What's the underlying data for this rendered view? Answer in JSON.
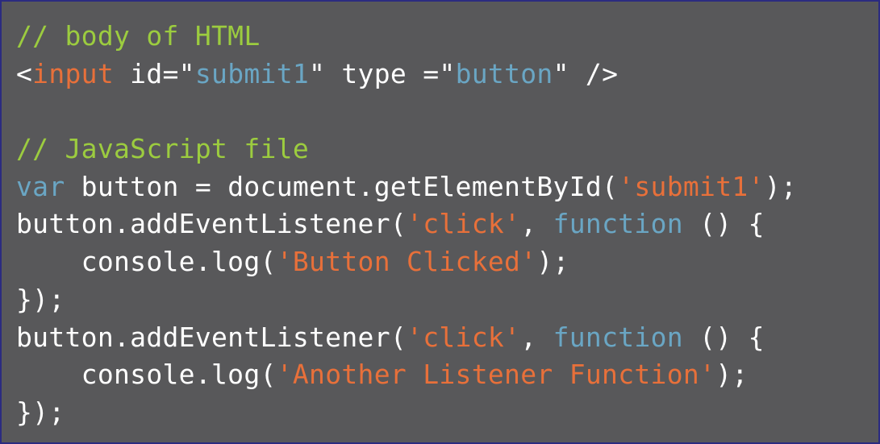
{
  "colors": {
    "background": "#58585a",
    "border": "#2b2b80",
    "comment": "#9ccc3f",
    "tag": "#e8703a",
    "keyword": "#6aa6c4",
    "string": "#e8703a",
    "plain": "#ffffff"
  },
  "code": {
    "lines": [
      [
        {
          "type": "comment",
          "text": "// body of HTML"
        }
      ],
      [
        {
          "type": "plain",
          "text": "<"
        },
        {
          "type": "tag",
          "text": "input"
        },
        {
          "type": "plain",
          "text": " id=\""
        },
        {
          "type": "attrval",
          "text": "submit1"
        },
        {
          "type": "plain",
          "text": "\" type =\""
        },
        {
          "type": "attrval",
          "text": "button"
        },
        {
          "type": "plain",
          "text": "\" />"
        }
      ],
      [],
      [
        {
          "type": "comment",
          "text": "// JavaScript file"
        }
      ],
      [
        {
          "type": "keyword",
          "text": "var"
        },
        {
          "type": "plain",
          "text": " button = document.getElementById("
        },
        {
          "type": "string",
          "text": "'submit1'"
        },
        {
          "type": "plain",
          "text": ");"
        }
      ],
      [
        {
          "type": "plain",
          "text": "button.addEventListener("
        },
        {
          "type": "string",
          "text": "'click'"
        },
        {
          "type": "plain",
          "text": ", "
        },
        {
          "type": "keyword",
          "text": "function"
        },
        {
          "type": "plain",
          "text": " () {"
        }
      ],
      [
        {
          "type": "plain",
          "text": "    console.log("
        },
        {
          "type": "string",
          "text": "'Button Clicked'"
        },
        {
          "type": "plain",
          "text": ");"
        }
      ],
      [
        {
          "type": "plain",
          "text": "});"
        }
      ],
      [
        {
          "type": "plain",
          "text": "button.addEventListener("
        },
        {
          "type": "string",
          "text": "'click'"
        },
        {
          "type": "plain",
          "text": ", "
        },
        {
          "type": "keyword",
          "text": "function"
        },
        {
          "type": "plain",
          "text": " () {"
        }
      ],
      [
        {
          "type": "plain",
          "text": "    console.log("
        },
        {
          "type": "string",
          "text": "'Another Listener Function'"
        },
        {
          "type": "plain",
          "text": ");"
        }
      ],
      [
        {
          "type": "plain",
          "text": "});"
        }
      ]
    ]
  }
}
